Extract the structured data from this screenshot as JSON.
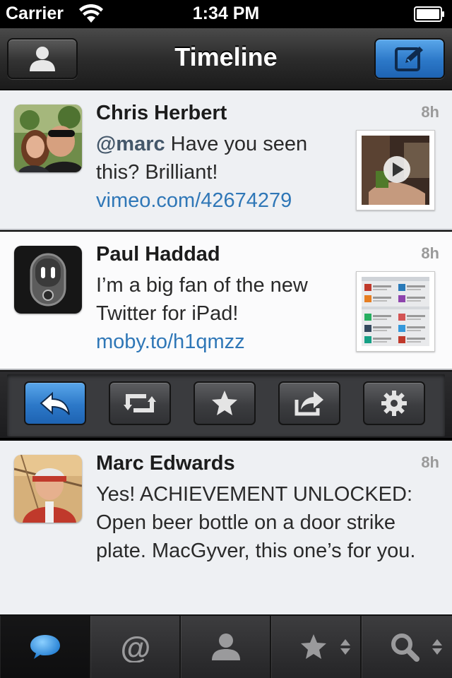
{
  "status": {
    "carrier": "Carrier",
    "time": "1:34 PM",
    "wifi_icon": "wifi-icon",
    "battery_icon": "battery-icon"
  },
  "nav": {
    "title": "Timeline",
    "left_icon": "profile-icon",
    "right_icon": "compose-icon",
    "accent_color": "#2c78c8"
  },
  "tweets": [
    {
      "name": "Chris Herbert",
      "time": "8h",
      "mention": "@marc",
      "text": " Have you seen this? Brilliant!",
      "link": "vimeo.com/42674279",
      "thumbnail": "video-thumbnail"
    },
    {
      "name": "Paul Haddad",
      "time": "8h",
      "text": "I’m a big fan of the new Twitter for iPad!",
      "link": "moby.to/h1qmzz",
      "thumbnail": "app-list-screenshot"
    },
    {
      "name": "Marc Edwards",
      "time": "8h",
      "text": "Yes! ACHIEVEMENT UNLOCKED: Open beer bottle on a door strike plate. MacGyver, this one’s for you."
    }
  ],
  "actions": [
    "reply-icon",
    "retweet-icon",
    "favorite-icon",
    "share-icon",
    "settings-icon"
  ],
  "tabs": [
    "timeline-icon",
    "mentions-icon",
    "profile-icon",
    "favorites-icon",
    "search-icon"
  ],
  "colors": {
    "link": "#2f77b7",
    "timestamp": "#9a9a9a",
    "tab_active": "#3a9ae6"
  }
}
